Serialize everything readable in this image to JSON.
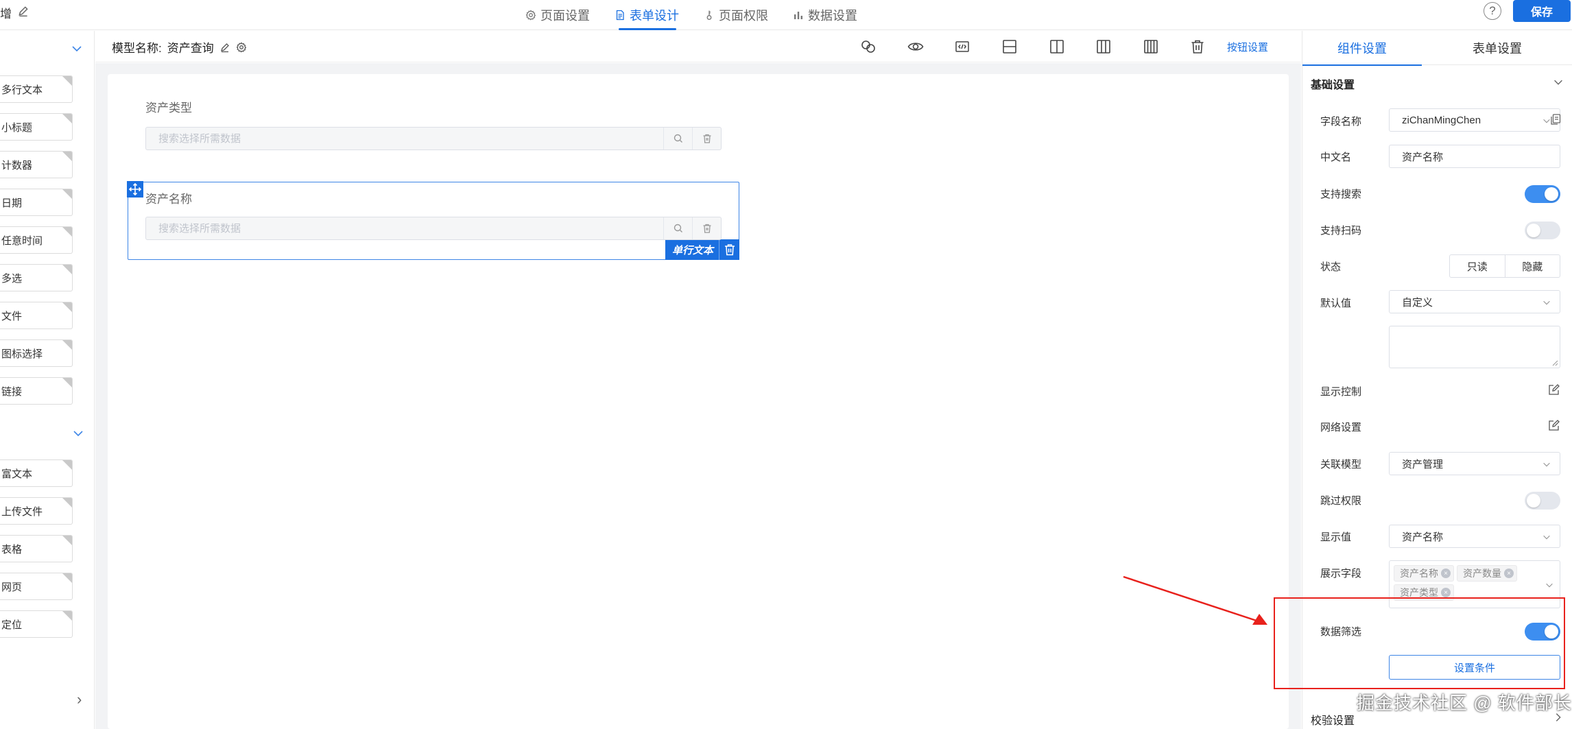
{
  "topbar": {
    "title_fragment": "增",
    "tabs": [
      {
        "label": "页面设置",
        "icon": "gear-icon",
        "active": false
      },
      {
        "label": "表单设计",
        "icon": "document-icon",
        "active": true
      },
      {
        "label": "页面权限",
        "icon": "key-icon",
        "active": false
      },
      {
        "label": "数据设置",
        "icon": "bar-chart-icon",
        "active": false
      }
    ],
    "help_glyph": "?",
    "save_label": "保存",
    "accent_color": "#1a6fe0"
  },
  "sidebar": {
    "group1_items": [
      "多行文本",
      "小标题",
      "计数器",
      "日期",
      "任意时间",
      "多选",
      "文件",
      "图标选择",
      "链接"
    ],
    "group2_items": [
      "富文本",
      "上传文件",
      "表格",
      "网页",
      "定位"
    ],
    "bottom_arrow": "›"
  },
  "subbar": {
    "model_label": "模型名称:",
    "model_value": "资产查询",
    "toolbar_icons": [
      "link-icon",
      "eye-icon",
      "code-icon",
      "split-horizontal-icon",
      "two-column-icon",
      "three-column-icon",
      "four-column-icon",
      "delete-icon"
    ],
    "button_settings_link": "按钮设置"
  },
  "canvas": {
    "fields": [
      {
        "label": "资产类型",
        "placeholder": "搜索选择所需数据",
        "selected": false
      },
      {
        "label": "资产名称",
        "placeholder": "搜索选择所需数据",
        "selected": true
      }
    ],
    "selected_component_tag": "单行文本"
  },
  "right_panel": {
    "tabs": [
      "组件设置",
      "表单设置"
    ],
    "active_tab": "组件设置",
    "section_basic": "基础设置",
    "section_validation": "校验设置",
    "labels": {
      "field_name": "字段名称",
      "chinese_name": "中文名",
      "support_search": "支持搜索",
      "support_scan": "支持扫码",
      "state": "状态",
      "default_value": "默认值",
      "display_control": "显示控制",
      "network_settings": "网络设置",
      "related_model": "关联模型",
      "skip_permission": "跳过权限",
      "display_value": "显示值",
      "display_fields": "展示字段",
      "data_filter": "数据筛选"
    },
    "values": {
      "field_name": "ziChanMingChen",
      "chinese_name": "资产名称",
      "state_options": [
        "只读",
        "隐藏"
      ],
      "default_value": "自定义",
      "related_model": "资产管理",
      "display_value": "资产名称",
      "display_fields": [
        "资产名称",
        "资产数量",
        "资产类型"
      ]
    },
    "toggles": {
      "support_search": true,
      "support_scan": false,
      "skip_permission": false,
      "data_filter": true
    },
    "set_condition_button": "设置条件"
  },
  "annotation": {
    "highlight_color": "#e8211c",
    "watermark": "掘金技术社区 @ 软件部长"
  }
}
